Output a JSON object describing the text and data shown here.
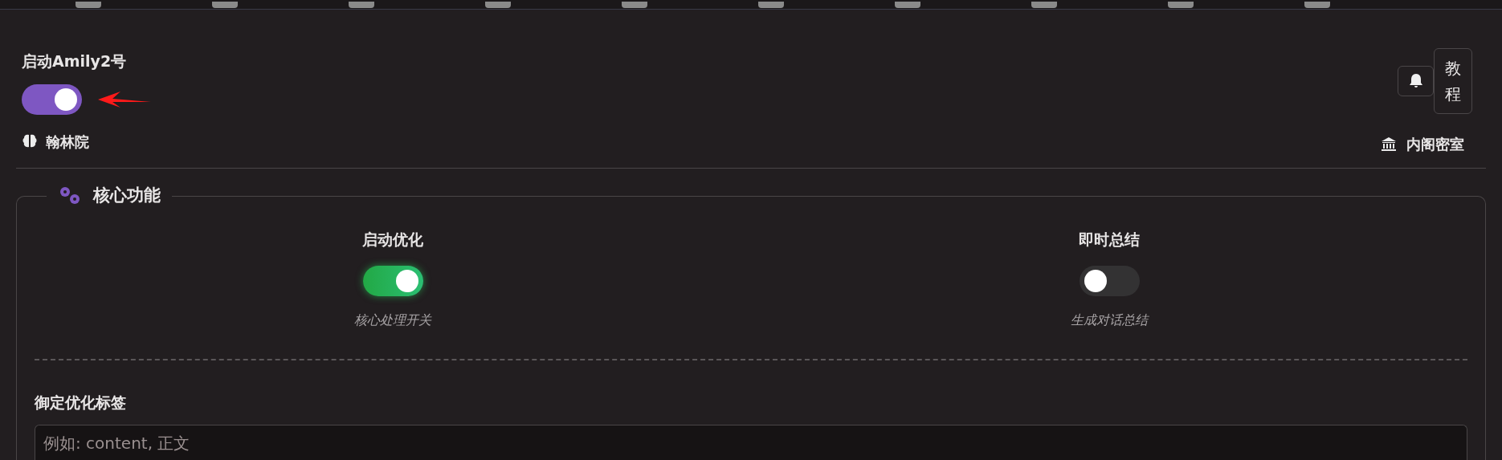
{
  "master_switch": {
    "label": "启动Amily2号",
    "on": true
  },
  "header_buttons": [
    {
      "kind": "bell"
    },
    {
      "kind": "text",
      "label": "教程"
    }
  ],
  "left_link": {
    "label": "翰林院"
  },
  "right_link": {
    "label": "内阁密室"
  },
  "core_section": {
    "title": "核心功能",
    "toggles": [
      {
        "label": "启动优化",
        "on": true,
        "description": "核心处理开关"
      },
      {
        "label": "即时总结",
        "on": false,
        "description": "生成对话总结"
      }
    ],
    "tag_field": {
      "label": "御定优化标签",
      "placeholder": "例如: content, 正文"
    }
  }
}
